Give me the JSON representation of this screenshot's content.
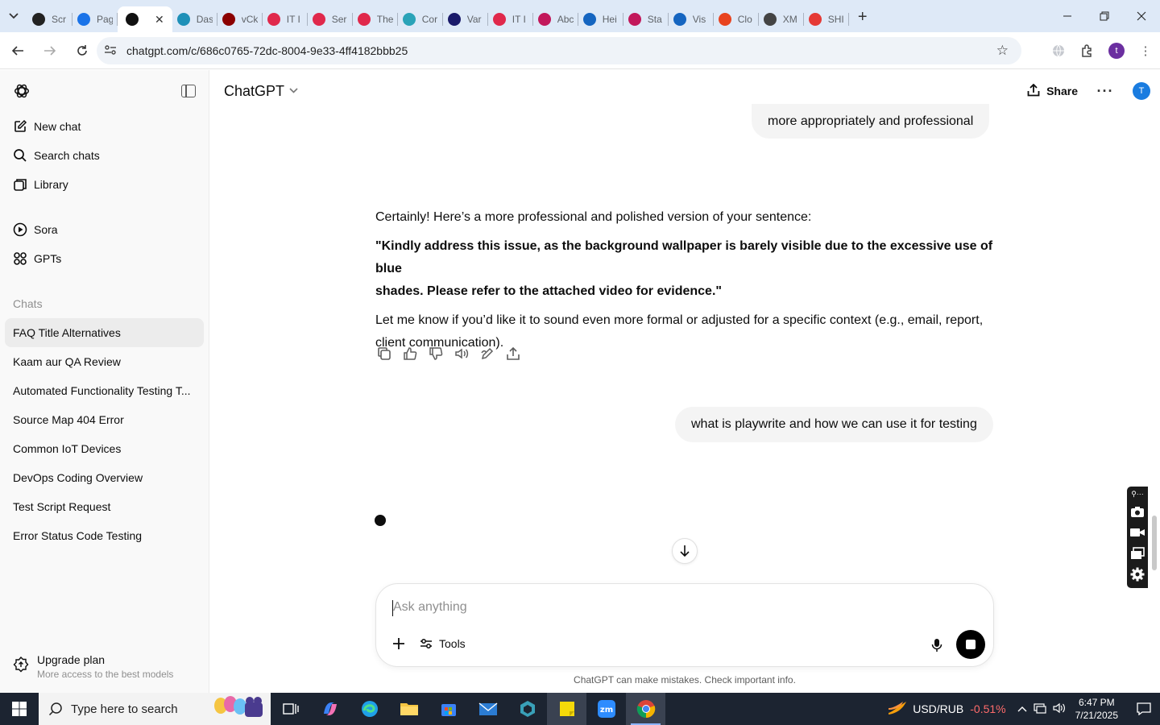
{
  "browser": {
    "tabs": [
      {
        "label": "Scr",
        "color": "#222222"
      },
      {
        "label": "Pag",
        "color": "#1a73e8"
      },
      {
        "label": "",
        "color": "#111111",
        "active": true
      },
      {
        "label": "Das",
        "color": "#1e90b8"
      },
      {
        "label": "vCk",
        "color": "#8b0000"
      },
      {
        "label": "IT I",
        "color": "#e0284b"
      },
      {
        "label": "Ser",
        "color": "#e0284b"
      },
      {
        "label": "The",
        "color": "#e0284b"
      },
      {
        "label": "Cor",
        "color": "#2aa3b8"
      },
      {
        "label": "Var",
        "color": "#1a1a6a"
      },
      {
        "label": "IT I",
        "color": "#e0284b"
      },
      {
        "label": "Abc",
        "color": "#c2185b"
      },
      {
        "label": "Hei",
        "color": "#1565c0"
      },
      {
        "label": "Sta",
        "color": "#c2185b"
      },
      {
        "label": "Vis",
        "color": "#1565c0"
      },
      {
        "label": "Clo",
        "color": "#e8431f"
      },
      {
        "label": "XM",
        "color": "#444444"
      },
      {
        "label": "SHI",
        "color": "#e53935"
      }
    ],
    "url": "chatgpt.com/c/686c0765-72dc-8004-9e33-4ff4182bbb25",
    "profile_initial": "t"
  },
  "sidebar": {
    "nav": [
      {
        "label": "New chat",
        "icon": "new-chat-icon"
      },
      {
        "label": "Search chats",
        "icon": "search-icon"
      },
      {
        "label": "Library",
        "icon": "library-icon"
      }
    ],
    "nav2": [
      {
        "label": "Sora",
        "icon": "sora-icon"
      },
      {
        "label": "GPTs",
        "icon": "gpts-icon"
      }
    ],
    "chats_heading": "Chats",
    "chats": [
      "FAQ Title Alternatives",
      "Kaam aur QA Review",
      "Automated Functionality Testing T...",
      "Source Map 404 Error",
      "Common IoT Devices",
      "DevOps Coding Overview",
      "Test Script Request",
      "Error Status Code Testing"
    ],
    "upgrade": {
      "title": "Upgrade plan",
      "subtitle": "More access to the best models"
    }
  },
  "header": {
    "model": "ChatGPT",
    "share_label": "Share",
    "avatar_initial": "T"
  },
  "conversation": {
    "user_msg_1": "more appropriately and professional",
    "assistant": {
      "intro": "Certainly! Here’s a more professional and polished version of your sentence:",
      "quote_line1": "\"Kindly address this issue, as the background wallpaper is barely visible due to the excessive use of blue",
      "quote_line2": "shades. Please refer to the attached video for evidence.\"",
      "outro_line1": "Let me know if you’d like it to sound even more formal or adjusted for a specific context (e.g., email, report,",
      "outro_line2": "client communication)."
    },
    "user_msg_2": "what is playwrite and how we can use it for testing"
  },
  "composer": {
    "placeholder": "Ask anything",
    "tools_label": "Tools"
  },
  "disclaimer": "ChatGPT can make mistakes. Check important info.",
  "taskbar": {
    "search_placeholder": "Type here to search",
    "ticker_symbol": "USD/RUB",
    "ticker_change": "-0.51%",
    "time": "6:47 PM",
    "date": "7/21/2025"
  }
}
